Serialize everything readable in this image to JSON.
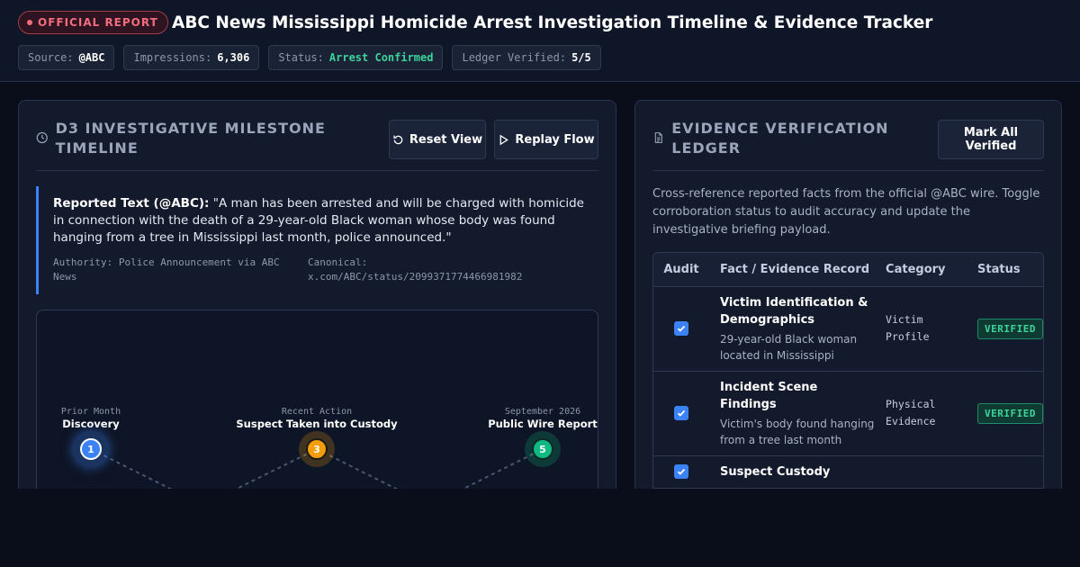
{
  "header": {
    "badge": "OFFICIAL REPORT",
    "title": "ABC News Mississippi Homicide Arrest Investigation Timeline & Evidence Tracker",
    "meta": [
      {
        "label": "Source:",
        "value": "@ABC",
        "accent": "#ffffff"
      },
      {
        "label": "Impressions:",
        "value": "6,306",
        "accent": "#ffffff"
      },
      {
        "label": "Status:",
        "value": "Arrest Confirmed",
        "accent": "#3ed39a"
      },
      {
        "label": "Ledger Verified:",
        "value": "5/5",
        "accent": "#ffffff"
      }
    ]
  },
  "timeline_panel": {
    "title": "D3 INVESTIGATIVE MILESTONE TIMELINE",
    "icon": "clock-icon",
    "reset_label": "Reset View",
    "replay_label": "Replay Flow",
    "quote": {
      "lead": "Reported Text (@ABC):",
      "text": " \"A man has been arrested and will be charged with homicide in connection with the death of a 29-year-old Black woman whose body was found hanging from a tree in Mississippi last month, police announced.\"",
      "authority": "Authority: Police Announcement via ABC News",
      "canonical": "Canonical: x.com/ABC/status/2099371774466981982"
    },
    "milestones": [
      {
        "number": "1",
        "date": "Prior Month",
        "name": "Discovery",
        "color": "#3b82f6"
      },
      {
        "number": "3",
        "date": "Recent Action",
        "name": "Suspect Taken into Custody",
        "color": "#f59e0b"
      },
      {
        "number": "5",
        "date": "September 2026",
        "name": "Public Wire Report",
        "color": "#10b981"
      }
    ]
  },
  "ledger_panel": {
    "title": "EVIDENCE VERIFICATION LEDGER",
    "icon": "document-icon",
    "mark_all_label": "Mark All Verified",
    "description": "Cross-reference reported facts from the official @ABC wire. Toggle corroboration status to audit accuracy and update the investigative briefing payload.",
    "columns": [
      "Audit",
      "Fact / Evidence Record",
      "Category",
      "Status"
    ],
    "rows": [
      {
        "checked": true,
        "title": "Victim Identification & Demographics",
        "detail": "29-year-old Black woman located in Mississippi",
        "category": "Victim Profile",
        "status": "VERIFIED"
      },
      {
        "checked": true,
        "title": "Incident Scene Findings",
        "detail": "Victim's body found hanging from a tree last month",
        "category": "Physical Evidence",
        "status": "VERIFIED"
      },
      {
        "checked": true,
        "title": "Suspect Custody",
        "detail": "",
        "category": "",
        "status": ""
      }
    ]
  },
  "colors": {
    "accent": "#3b82f6",
    "verified": "#3ed39a",
    "official": "#f26d7d"
  }
}
